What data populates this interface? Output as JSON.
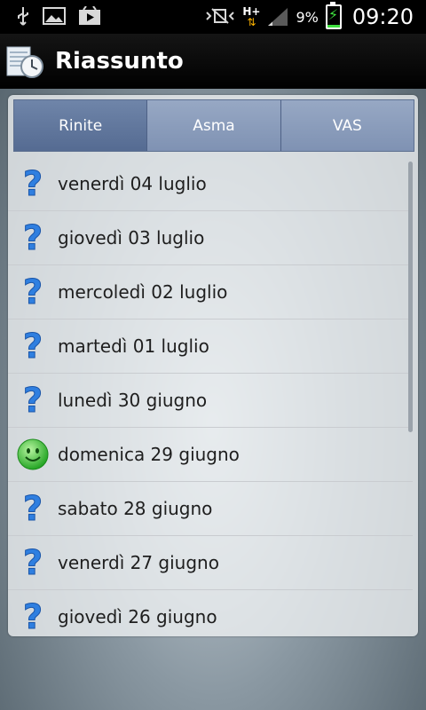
{
  "status_bar": {
    "left_icons": [
      "usb-icon",
      "image-icon",
      "play-icon"
    ],
    "network": "H+",
    "battery_percent": "9%",
    "time": "09:20",
    "colors": {
      "battery_fill": "#3fe13f",
      "network_arrow": "#ffb400"
    }
  },
  "app": {
    "title": "Riassunto"
  },
  "tabs": [
    {
      "label": "Rinite",
      "selected": true
    },
    {
      "label": "Asma",
      "selected": false
    },
    {
      "label": "VAS",
      "selected": false
    }
  ],
  "rows": [
    {
      "label": "venerdì 04 luglio",
      "icon": "question-icon"
    },
    {
      "label": "giovedì 03 luglio",
      "icon": "question-icon"
    },
    {
      "label": "mercoledì 02 luglio",
      "icon": "question-icon"
    },
    {
      "label": "martedì 01 luglio",
      "icon": "question-icon"
    },
    {
      "label": "lunedì 30 giugno",
      "icon": "question-icon"
    },
    {
      "label": "domenica 29 giugno",
      "icon": "smiley-icon"
    },
    {
      "label": "sabato 28 giugno",
      "icon": "question-icon"
    },
    {
      "label": "venerdì 27 giugno",
      "icon": "question-icon"
    },
    {
      "label": "giovedì 26 giugno",
      "icon": "question-icon"
    }
  ],
  "colors": {
    "question_icon": "#2f7fe0",
    "smiley": "#34c634",
    "tab_selected": "#556b92",
    "tab": "#8597b6"
  }
}
